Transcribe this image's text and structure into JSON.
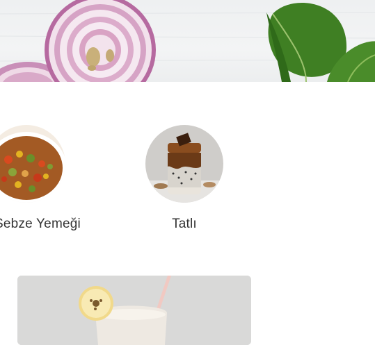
{
  "hero": {
    "image": "onion-and-spinach-banner"
  },
  "categories": [
    {
      "label": "Sebze Yemeği",
      "icon": "vegetable-stew-image"
    },
    {
      "label": "Tatlı",
      "icon": "dessert-jar-image"
    }
  ],
  "promo": {
    "image": "banana-smoothie-image"
  },
  "colors": {
    "text": "#333333",
    "background": "#ffffff"
  }
}
